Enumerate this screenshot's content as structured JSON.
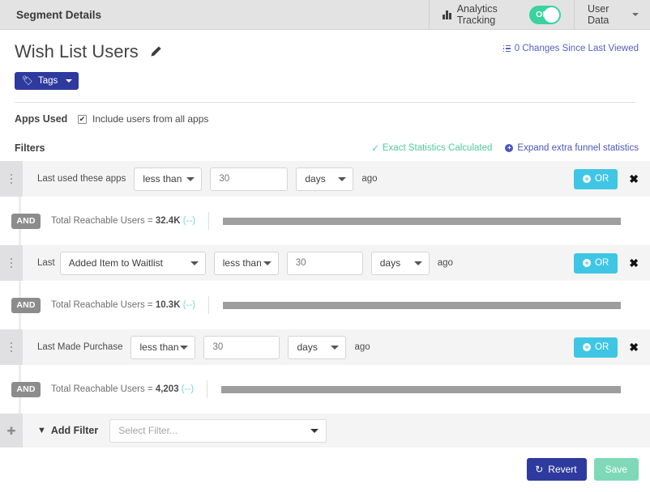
{
  "topbar": {
    "title": "Segment Details",
    "analytics_label": "Analytics Tracking",
    "toggle_state": "ON",
    "user_menu": "User Data",
    "chart_icon": "bar-chart-icon",
    "caret_icon": "chevron-down-icon"
  },
  "header": {
    "segment_name": "Wish List Users",
    "edit_icon": "pencil-icon",
    "changes_text": "0 Changes Since Last Viewed",
    "changes_icon": "list-icon",
    "tags_label": "Tags",
    "tags_icon": "tag-icon"
  },
  "apps_used": {
    "label": "Apps Used",
    "checkbox_label": "Include users from all apps",
    "checkbox_checked": true,
    "check_glyph": "✔"
  },
  "filters": {
    "title": "Filters",
    "exact_stats": "Exact Statistics Calculated",
    "exact_stats_icon": "check-icon",
    "exact_stats_color": "#51c99a",
    "expand_link": "Expand extra funnel statistics",
    "expand_icon": "plus-circle-icon",
    "or_label": "OR",
    "close_glyph": "✖",
    "and_label": "AND",
    "stat_prefix": "Total Reachable Users = ",
    "stat_suffix": "(--)",
    "accent_or": "#3fc6e4",
    "rows": [
      {
        "label": "Last used these apps",
        "has_event_select": false,
        "comparator": "less than",
        "value": "30",
        "unit": "days",
        "ago": "ago",
        "stat_value": "32.4K",
        "bar_percent": 100
      },
      {
        "label": "Last",
        "has_event_select": true,
        "event": "Added Item to Waitlist",
        "comparator": "less than",
        "value": "30",
        "unit": "days",
        "ago": "ago",
        "stat_value": "10.3K",
        "bar_percent": 100
      },
      {
        "label": "Last Made Purchase",
        "has_event_select": false,
        "comparator": "less than",
        "value": "30",
        "unit": "days",
        "ago": "ago",
        "stat_value": "4,203",
        "bar_percent": 100
      }
    ],
    "add_filter": {
      "label": "Add Filter",
      "icon": "funnel-icon",
      "placeholder": "Select Filter...",
      "plus_icon": "plus-icon"
    }
  },
  "footer": {
    "revert_label": "Revert",
    "revert_icon": "undo-icon",
    "save_label": "Save"
  }
}
